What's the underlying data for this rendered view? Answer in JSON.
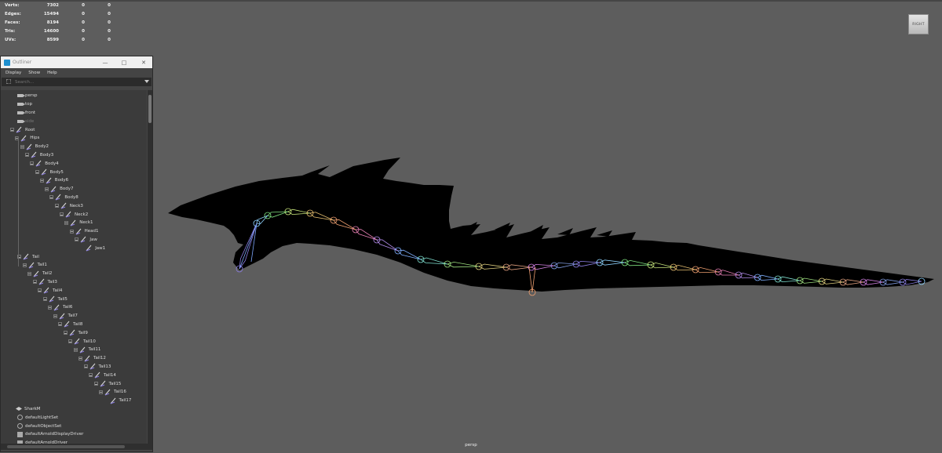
{
  "hud": {
    "rows": [
      {
        "label": "Verts:",
        "v": "7302",
        "c1": "0",
        "c2": "0"
      },
      {
        "label": "Edges:",
        "v": "15494",
        "c1": "0",
        "c2": "0"
      },
      {
        "label": "Faces:",
        "v": "8194",
        "c1": "0",
        "c2": "0"
      },
      {
        "label": "Tris:",
        "v": "14600",
        "c1": "0",
        "c2": "0"
      },
      {
        "label": "UVs:",
        "v": "8599",
        "c1": "0",
        "c2": "0"
      }
    ]
  },
  "viewcube": {
    "label": "RIGHT"
  },
  "viewport": {
    "camera": "persp"
  },
  "outliner": {
    "title": "Outliner",
    "menu": [
      "Display",
      "Show",
      "Help"
    ],
    "search_placeholder": "Search...",
    "cameras": [
      "persp",
      "top",
      "front",
      "side"
    ],
    "joints": [
      "Root",
      "Hips",
      "Body2",
      "Body3",
      "Body4",
      "Body5",
      "Body6",
      "Body7",
      "Body8",
      "Neck3",
      "Neck2",
      "Neck1",
      "Head1",
      "Jaw",
      "Jaw1",
      "Tail",
      "Tail1",
      "Tail2",
      "Tail3",
      "Tail4",
      "Tail5",
      "Tail6",
      "Tail7",
      "Tail8",
      "Tail9",
      "Tail10",
      "Tail11",
      "Tail12",
      "Tail13",
      "Tail14",
      "Tail15",
      "Tail16",
      "Tail17"
    ],
    "mesh": "SharkM",
    "sets": [
      "defaultLightSet",
      "defaultObjectSet"
    ],
    "drivers": [
      "defaultArnoldDisplayDriver",
      "defaultArnoldDriver"
    ]
  },
  "colors": {
    "viewport_bg": "#5d5d5d",
    "silhouette": "#000000",
    "joint_accent": "#8a7de0"
  }
}
